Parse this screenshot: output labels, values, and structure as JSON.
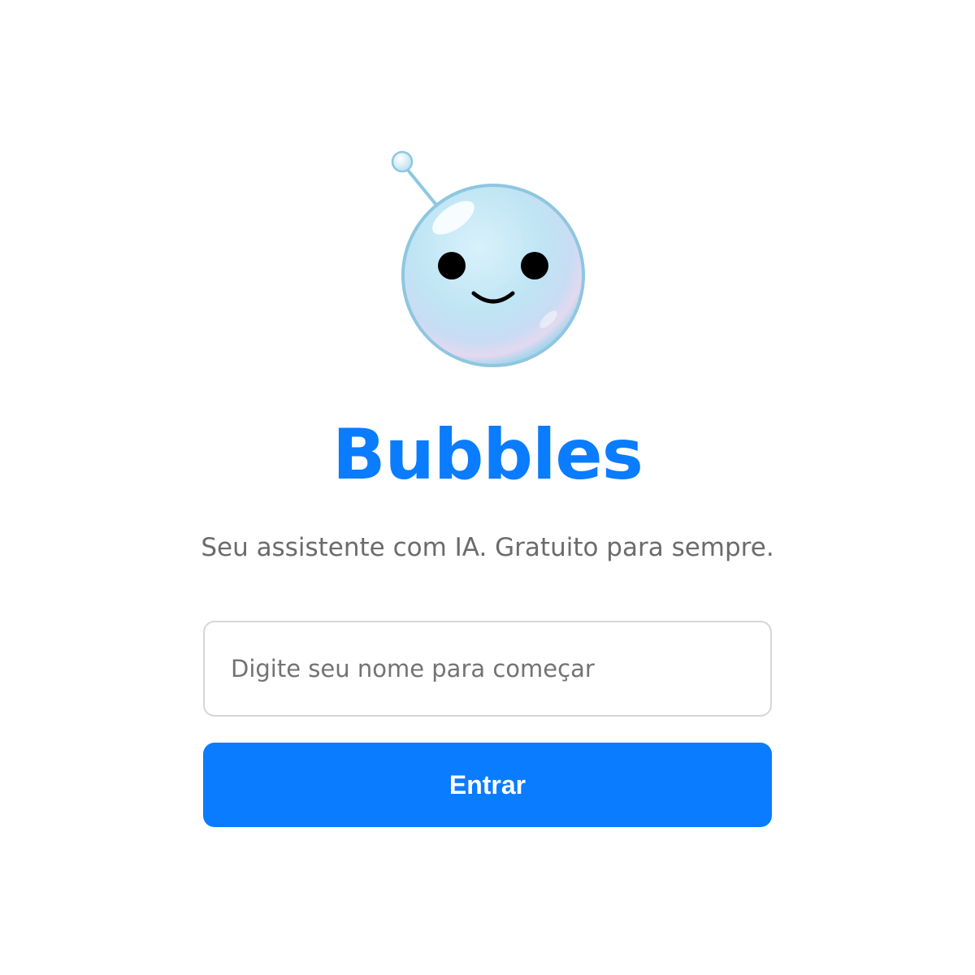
{
  "app": {
    "title": "Bubbles",
    "tagline": "Seu assistente com IA. Gratuito para sempre."
  },
  "login": {
    "name_placeholder": "Digite seu nome para começar",
    "name_value": "",
    "enter_label": "Entrar"
  },
  "mascot": {
    "icon": "bubble-robot-mascot-icon"
  },
  "colors": {
    "accent": "#0a7cff",
    "title": "#0a7cff",
    "tagline": "#6b6b6b",
    "input_border": "#d6d6d6",
    "button_text": "#ffffff"
  }
}
